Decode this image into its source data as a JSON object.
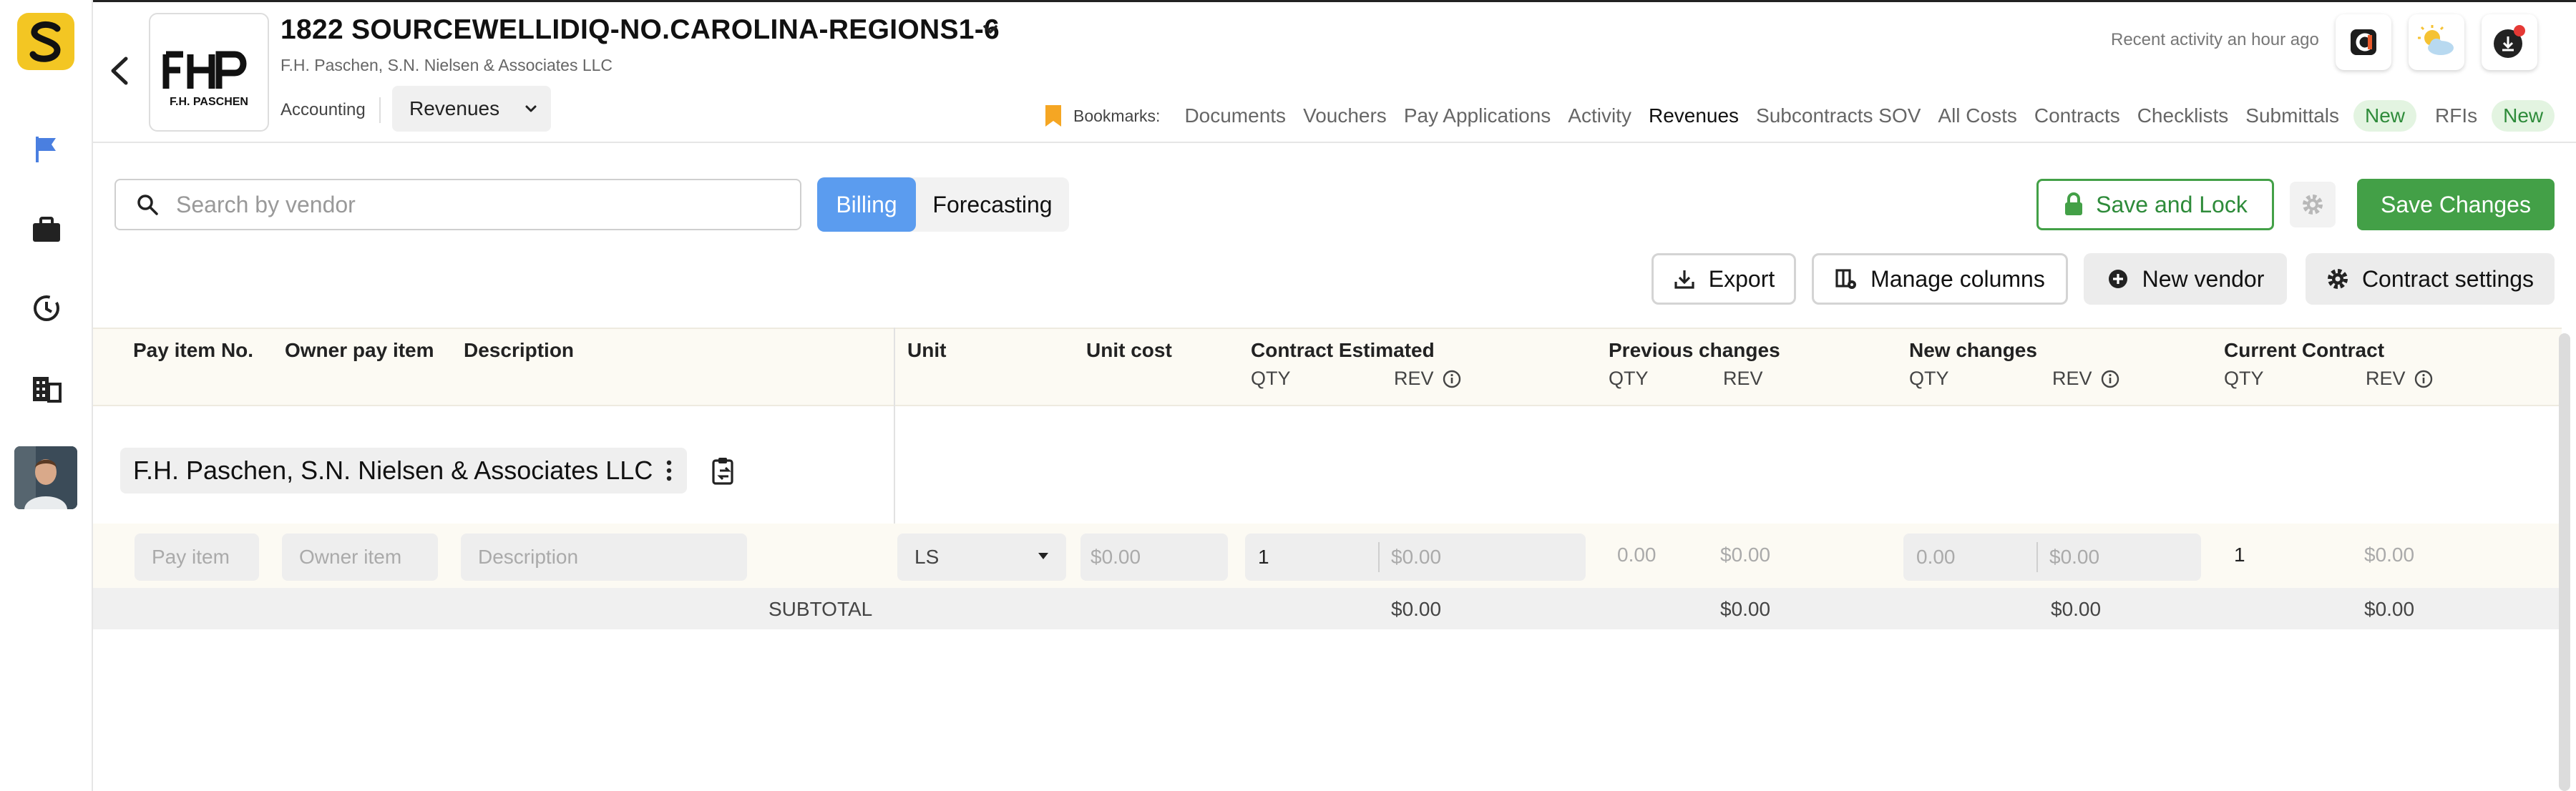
{
  "project": {
    "title": "1822 SOURCEWELLIDIQ-NO.CAROLINA-REGIONS1-6",
    "subtitle": "F.H. Paschen, S.N. Nielsen & Associates LLC",
    "logo_text": "F.H. PASCHEN",
    "section": "Accounting",
    "current_module": "Revenues"
  },
  "header": {
    "recent_activity": "Recent activity an hour ago",
    "bookmarks_label": "Bookmarks:",
    "nav": [
      {
        "label": "Documents"
      },
      {
        "label": "Vouchers"
      },
      {
        "label": "Pay Applications"
      },
      {
        "label": "Activity"
      },
      {
        "label": "Revenues",
        "active": true
      },
      {
        "label": "Subcontracts SOV"
      },
      {
        "label": "All Costs"
      },
      {
        "label": "Contracts"
      },
      {
        "label": "Checklists"
      },
      {
        "label": "Submittals",
        "badge": "New"
      },
      {
        "label": "RFIs",
        "badge": "New"
      }
    ]
  },
  "toolbar": {
    "search_placeholder": "Search by vendor",
    "seg_billing": "Billing",
    "seg_forecasting": "Forecasting",
    "save_lock": "Save and Lock",
    "save_changes": "Save Changes",
    "export": "Export",
    "manage_columns": "Manage columns",
    "new_vendor": "New vendor",
    "contract_settings": "Contract settings"
  },
  "table": {
    "headers": {
      "pay_item_no": "Pay item No.",
      "owner_pay_item": "Owner pay item",
      "description": "Description",
      "unit": "Unit",
      "unit_cost": "Unit cost",
      "contract_estimated": "Contract Estimated",
      "previous_changes": "Previous changes",
      "new_changes": "New changes",
      "current_contract": "Current Contract",
      "qty": "QTY",
      "rev": "REV"
    },
    "group_name": "F.H. Paschen, S.N. Nielsen & Associates LLC",
    "edit_row": {
      "pay_item_placeholder": "Pay item",
      "owner_item_placeholder": "Owner item",
      "description_placeholder": "Description",
      "unit": "LS",
      "unit_cost": "$0.00",
      "ce_qty": "1",
      "ce_rev": "$0.00",
      "pc_qty": "0.00",
      "pc_rev": "$0.00",
      "nc_qty": "0.00",
      "nc_rev": "$0.00",
      "cc_qty": "1",
      "cc_rev": "$0.00"
    },
    "subtotal": {
      "label": "SUBTOTAL",
      "ce_rev": "$0.00",
      "pc_rev": "$0.00",
      "nc_rev": "$0.00",
      "cc_rev": "$0.00"
    }
  },
  "colors": {
    "accent_green": "#43a047",
    "accent_blue": "#5b9cef",
    "brand_yellow": "#f3c623",
    "sidebar_active": "#4a7fe0"
  }
}
